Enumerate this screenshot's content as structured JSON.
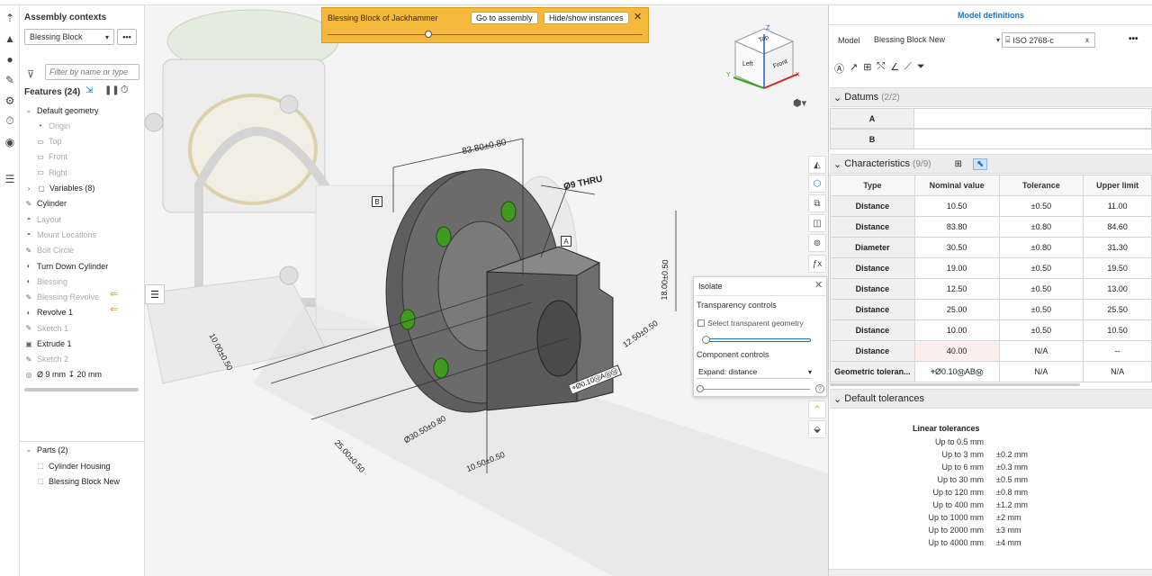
{
  "feature_panel": {
    "assembly_contexts_label": "Assembly contexts",
    "context_select": "Blessing Block",
    "filter_placeholder": "Filter by name or type",
    "features_label": "Features (24)",
    "tree": [
      {
        "label": "Default geometry",
        "dim": false,
        "icon": "chevron-down"
      },
      {
        "label": "Origin",
        "dim": true,
        "icon": "dot"
      },
      {
        "label": "Top",
        "dim": true,
        "icon": "plane"
      },
      {
        "label": "Front",
        "dim": true,
        "icon": "plane"
      },
      {
        "label": "Right",
        "dim": true,
        "icon": "plane"
      },
      {
        "label": "Variables (8)",
        "dim": false,
        "icon": "folder"
      },
      {
        "label": "Cylinder",
        "dim": false,
        "icon": "sketch"
      },
      {
        "label": "Layout",
        "dim": true,
        "icon": "mate"
      },
      {
        "label": "Mount Locations",
        "dim": true,
        "icon": "mate"
      },
      {
        "label": "Bolt Circle",
        "dim": true,
        "icon": "sketch"
      },
      {
        "label": "Turn Down Cylinder",
        "dim": false,
        "icon": "revolve"
      },
      {
        "label": "Blessing",
        "dim": true,
        "icon": "revolve"
      },
      {
        "label": "Blessing Revolve",
        "dim": true,
        "icon": "sketch"
      },
      {
        "label": "Revolve 1",
        "dim": false,
        "icon": "revolve"
      },
      {
        "label": "Sketch 1",
        "dim": true,
        "icon": "sketch"
      },
      {
        "label": "Extrude 1",
        "dim": false,
        "icon": "extrude"
      },
      {
        "label": "Sketch 2",
        "dim": true,
        "icon": "sketch"
      },
      {
        "label": "Ø 9 mm ↧ 20 mm",
        "dim": false,
        "icon": "hole"
      }
    ],
    "parts_label": "Parts (2)",
    "parts": [
      "Cylinder Housing",
      "Blessing Block New"
    ]
  },
  "banner": {
    "title": "Blessing Block of Jackhammer",
    "go_button": "Go to assembly",
    "hide_button": "Hide/show instances",
    "slider_fraction": 0.32
  },
  "viewcube": {
    "top": "Top",
    "left": "Left",
    "front": "Front",
    "x": "X",
    "y": "Y",
    "z": "Z"
  },
  "dimensions": {
    "d1": "83.80±0.80",
    "d2": "Ø9 THRU",
    "d3": "18.00±0.50",
    "d4": "12.50±0.50",
    "d5": "10.00±0.50",
    "d6": "25.00±0.50",
    "d7": "Ø30.50±0.80",
    "d8": "10.50±0.50",
    "datum_a": "A",
    "datum_b": "B",
    "fcf": "⌖Ø0.10ⓂAⒷⓂ"
  },
  "isolate": {
    "title": "Isolate",
    "transparency_label": "Transparency controls",
    "checkbox_label": "Select transparent geometry",
    "component_label": "Component controls",
    "expand_select": "Expand: distance"
  },
  "right_panel": {
    "title": "Model definitions",
    "model_label": "Model",
    "model_select": "Blessing Block New",
    "standard_select": "ISO 2768-c",
    "standard_clear": "x",
    "datums_label": "Datums",
    "datums_count": "(2/2)",
    "datums": [
      "A",
      "B"
    ],
    "characteristics_label": "Characteristics",
    "characteristics_count": "(9/9)",
    "columns": [
      "Type",
      "Nominal value",
      "Tolerance",
      "Upper limit"
    ],
    "rows": [
      [
        "Distance",
        "10.50",
        "±0.50",
        "11.00"
      ],
      [
        "Distance",
        "83.80",
        "±0.80",
        "84.60"
      ],
      [
        "Diameter",
        "30.50",
        "±0.80",
        "31.30"
      ],
      [
        "Distance",
        "19.00",
        "±0.50",
        "19.50"
      ],
      [
        "Distance",
        "12.50",
        "±0.50",
        "13.00"
      ],
      [
        "Distance",
        "25.00",
        "±0.50",
        "25.50"
      ],
      [
        "Distance",
        "10.00",
        "±0.50",
        "10.50"
      ],
      [
        "Distance",
        "40.00",
        "N/A",
        "--"
      ],
      [
        "Geometric toleran...",
        "⌖Ø0.10ⓂABⓂ",
        "N/A",
        "N/A"
      ]
    ],
    "default_tol_label": "Default tolerances",
    "linear_label": "Linear tolerances",
    "linear": [
      [
        "Up to 0.5 mm",
        ""
      ],
      [
        "Up to 3 mm",
        "±0.2 mm"
      ],
      [
        "Up to 6 mm",
        "±0.3 mm"
      ],
      [
        "Up to 30 mm",
        "±0.5 mm"
      ],
      [
        "Up to 120 mm",
        "±0.8 mm"
      ],
      [
        "Up to 400 mm",
        "±1.2 mm"
      ],
      [
        "Up to 1000 mm",
        "±2 mm"
      ],
      [
        "Up to 2000 mm",
        "±3 mm"
      ],
      [
        "Up to 4000 mm",
        "±4 mm"
      ]
    ]
  },
  "colors": {
    "accent": "#1a73c9",
    "banner": "#f6b93b",
    "part": "#5a5a5a",
    "hole": "#3f9a1f",
    "warn": "#d7a11a"
  }
}
